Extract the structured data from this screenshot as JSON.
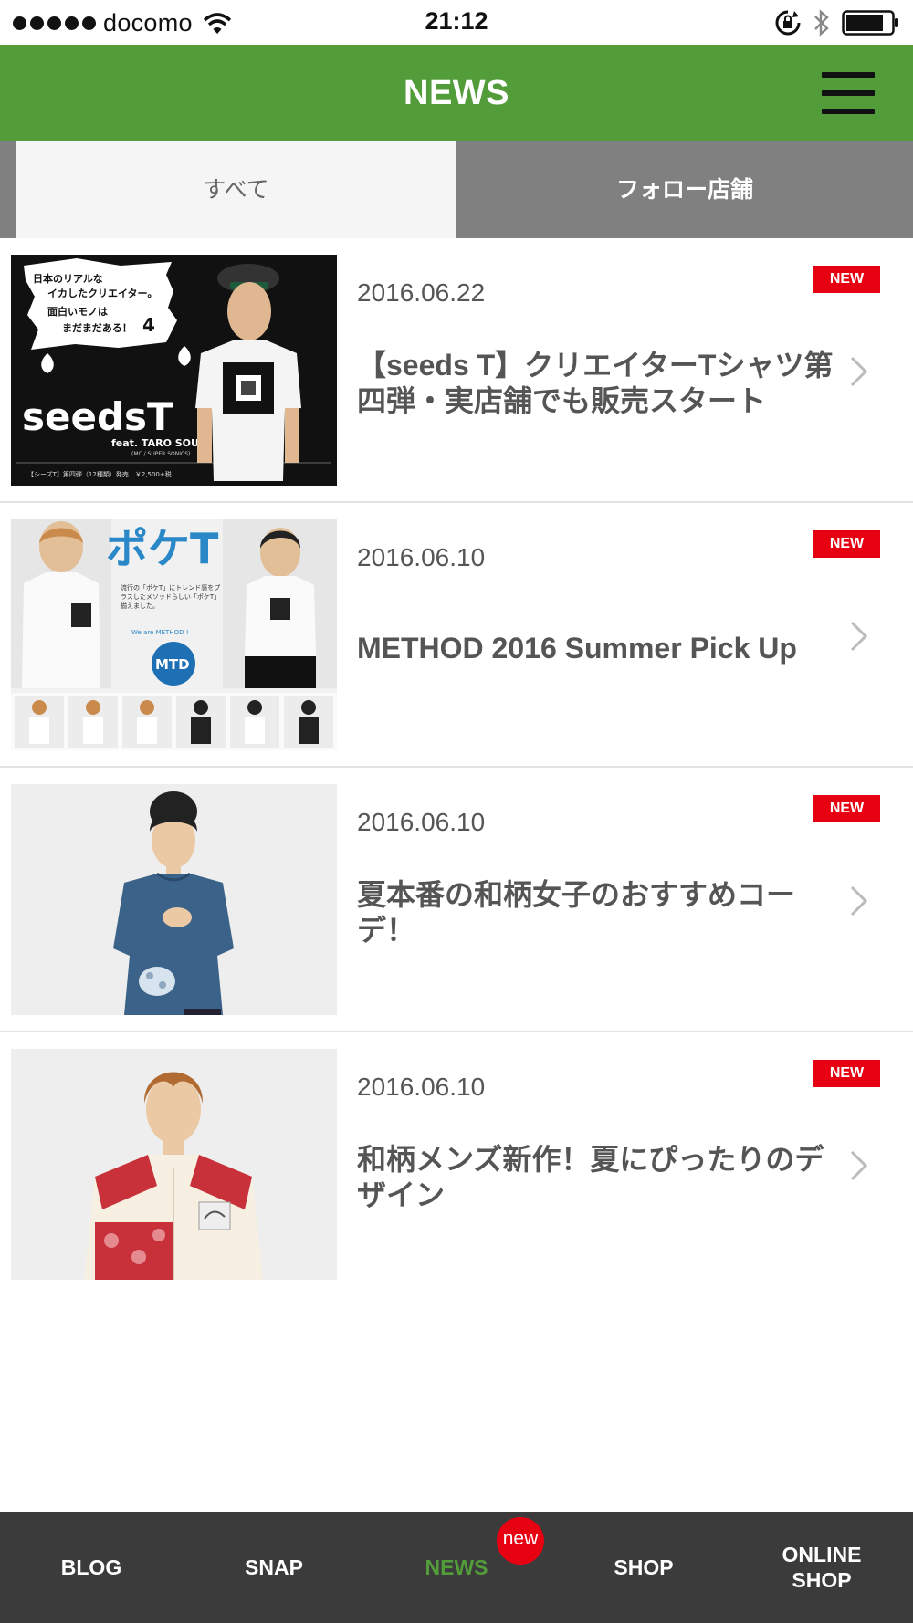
{
  "status_bar": {
    "carrier": "docomo",
    "time": "21:12"
  },
  "header": {
    "title": "NEWS"
  },
  "tabs": [
    {
      "label": "すべて",
      "selected": true
    },
    {
      "label": "フォロー店舗",
      "selected": false
    }
  ],
  "news": [
    {
      "date": "2016.06.22",
      "title": "【seeds T】クリエイターTシャツ第四弾・実店舗でも販売スタート",
      "badge": "NEW"
    },
    {
      "date": "2016.06.10",
      "title": "METHOD 2016 Summer Pick Up",
      "badge": "NEW"
    },
    {
      "date": "2016.06.10",
      "title": "夏本番の和柄女子のおすすめコーデ！",
      "badge": "NEW"
    },
    {
      "date": "2016.06.10",
      "title": "和柄メンズ新作！夏にぴったりのデザイン",
      "badge": "NEW"
    }
  ],
  "thumbs": {
    "seeds": {
      "bubble_line1": "日本のリアルな",
      "bubble_line2": "イカしたクリエイター。",
      "bubble_line3": "面白いモノは",
      "bubble_line4": "まだまだある！",
      "bubble_number": "4",
      "logo": "seedsT",
      "feat": "feat. TARO SOUL",
      "feat_sub": "(MC / SUPER SONICS)",
      "caption": "【シーズT】第四弾（12種類）発売　￥2,500+税"
    },
    "method": {
      "title": "ポケT",
      "desc": "流行の「ポケT」にトレンド感をプラスしたメソッドらしい「ポケT」揃えました。",
      "tagline": "We are METHOD !",
      "logo": "MTD"
    }
  },
  "tabbar": {
    "items": [
      {
        "label": "BLOG",
        "active": false
      },
      {
        "label": "SNAP",
        "active": false
      },
      {
        "label": "NEWS",
        "active": true
      },
      {
        "label": "SHOP",
        "active": false
      },
      {
        "label": "ONLINE SHOP",
        "active": false
      }
    ],
    "news_dot": "new"
  },
  "colors": {
    "brand_green": "#539c3a",
    "badge_red": "#e60012",
    "tabbar_bg": "#3b3b3b",
    "tab_gray": "#808080"
  },
  "icons": [
    "signal-dots-icon",
    "wifi-icon",
    "rotation-lock-icon",
    "bluetooth-icon",
    "battery-icon",
    "hamburger-menu-icon",
    "chevron-right-icon"
  ]
}
